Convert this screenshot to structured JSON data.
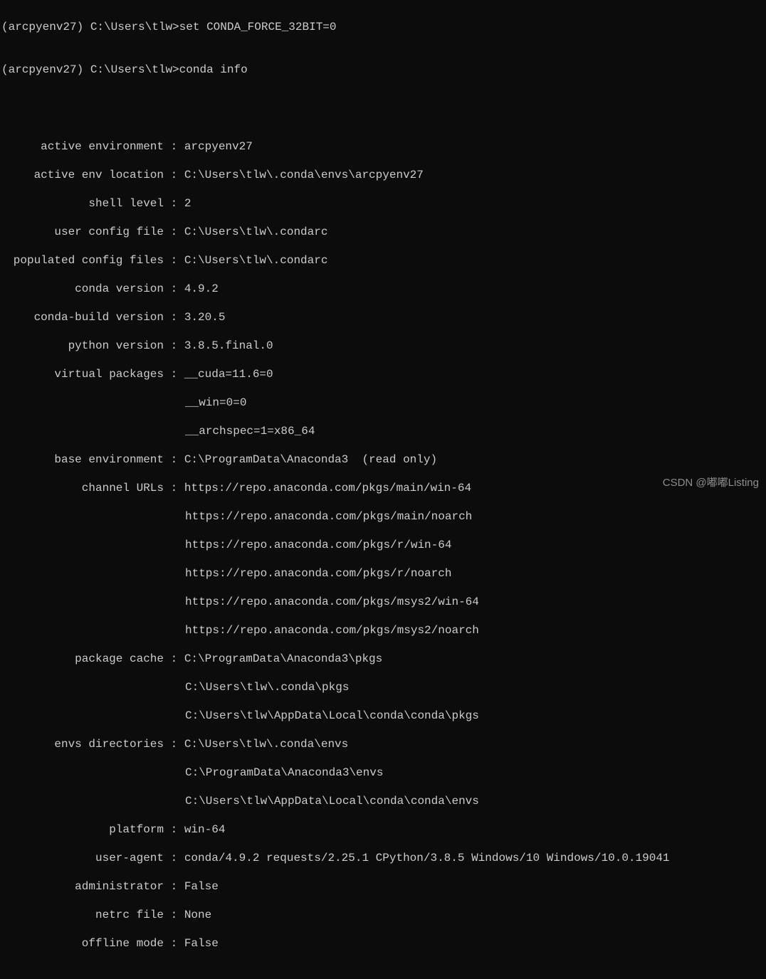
{
  "prompt1": {
    "env": "(arcpyenv27)",
    "path": "C:\\Users\\tlw>",
    "command": "set CONDA_FORCE_32BIT=0"
  },
  "prompt2": {
    "env": "(arcpyenv27)",
    "path": "C:\\Users\\tlw>",
    "command": "conda info"
  },
  "info": {
    "active_environment_label": "active environment",
    "active_environment": "arcpyenv27",
    "active_env_location_label": "active env location",
    "active_env_location": "C:\\Users\\tlw\\.conda\\envs\\arcpyenv27",
    "shell_level_label": "shell level",
    "shell_level": "2",
    "user_config_file_label": "user config file",
    "user_config_file": "C:\\Users\\tlw\\.condarc",
    "populated_config_files_label": "populated config files",
    "populated_config_files": "C:\\Users\\tlw\\.condarc",
    "conda_version_label": "conda version",
    "conda_version": "4.9.2",
    "conda_build_version_label": "conda-build version",
    "conda_build_version": "3.20.5",
    "python_version_label": "python version",
    "python_version": "3.8.5.final.0",
    "virtual_packages_label": "virtual packages",
    "virtual_packages_1": "__cuda=11.6=0",
    "virtual_packages_2": "__win=0=0",
    "virtual_packages_3": "__archspec=1=x86_64",
    "base_environment_label": "base environment",
    "base_environment": "C:\\ProgramData\\Anaconda3  (read only)",
    "channel_urls_label": "channel URLs",
    "channel_urls_1": "https://repo.anaconda.com/pkgs/main/win-64",
    "channel_urls_2": "https://repo.anaconda.com/pkgs/main/noarch",
    "channel_urls_3": "https://repo.anaconda.com/pkgs/r/win-64",
    "channel_urls_4": "https://repo.anaconda.com/pkgs/r/noarch",
    "channel_urls_5": "https://repo.anaconda.com/pkgs/msys2/win-64",
    "channel_urls_6": "https://repo.anaconda.com/pkgs/msys2/noarch",
    "package_cache_label": "package cache",
    "package_cache_1": "C:\\ProgramData\\Anaconda3\\pkgs",
    "package_cache_2": "C:\\Users\\tlw\\.conda\\pkgs",
    "package_cache_3": "C:\\Users\\tlw\\AppData\\Local\\conda\\conda\\pkgs",
    "envs_directories_label": "envs directories",
    "envs_directories_1": "C:\\Users\\tlw\\.conda\\envs",
    "envs_directories_2": "C:\\ProgramData\\Anaconda3\\envs",
    "envs_directories_3": "C:\\Users\\tlw\\AppData\\Local\\conda\\conda\\envs",
    "platform_label": "platform",
    "platform": "win-64",
    "user_agent_label": "user-agent",
    "user_agent": "conda/4.9.2 requests/2.25.1 CPython/3.8.5 Windows/10 Windows/10.0.19041",
    "administrator_label": "administrator",
    "administrator": "False",
    "netrc_file_label": "netrc file",
    "netrc_file": "None",
    "offline_mode_label": "offline mode",
    "offline_mode": "False"
  },
  "separator": " : ",
  "watermark": "CSDN @嘟嘟Listing"
}
